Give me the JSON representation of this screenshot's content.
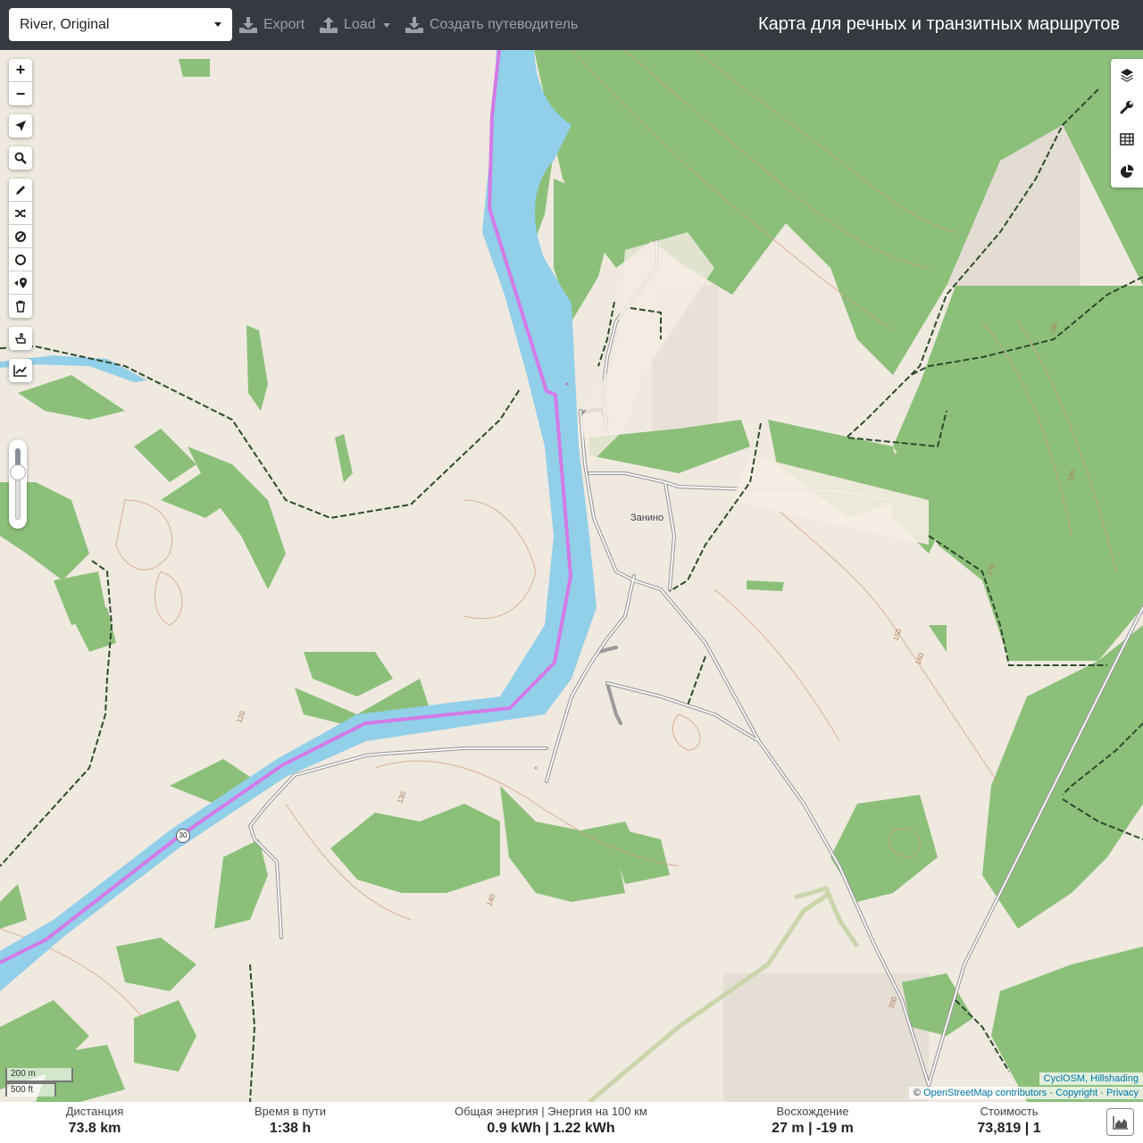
{
  "navbar": {
    "profile": "River, Original",
    "export_label": "Export",
    "load_label": "Load",
    "guide_label": "Создать путеводитель",
    "title": "Карта для речных и транзитных маршрутов"
  },
  "map": {
    "village_label": "Занино",
    "road_shield": "30",
    "contour_labels": [
      "120",
      "130",
      "140",
      "150",
      "160",
      "170",
      "180",
      "190",
      "200"
    ],
    "zoom_level_fraction": 0.3
  },
  "left_tools": {
    "zoom": [
      "zoom-in",
      "zoom-out"
    ],
    "locate": "location-arrow-icon",
    "search": "search-icon",
    "drawing": [
      "pencil-icon",
      "shuffle-icon",
      "ban-icon",
      "circle-icon",
      "poi-icon",
      "trash-icon"
    ],
    "hand": "hand-pointer-icon",
    "elevation": "chart-line-icon"
  },
  "right_tools": [
    "layers-icon",
    "wrench-icon",
    "table-icon",
    "pie-chart-icon"
  ],
  "scale": {
    "metric": "200 m",
    "imperial": "500 ft"
  },
  "attribution": {
    "line1": "CyclOSM, Hillshading",
    "prefix": "©",
    "osm": "OpenStreetMap contributors",
    "sep1": "·",
    "copyright": "Copyright",
    "sep2": "·",
    "privacy": "Privacy"
  },
  "stats": {
    "distance_label": "Дистанция",
    "distance_value": "73.8 km",
    "time_label": "Время в пути",
    "time_value": "1:38 h",
    "energy_label": "Общая энергия | Энергия на 100 км",
    "energy_value": "0.9 kWh | 1.22 kWh",
    "ascent_label": "Восхождение",
    "ascent_value": "27 m | -19 m",
    "cost_label": "Стоимость",
    "cost_value": "73,819 | 1"
  },
  "colors": {
    "navbar": "#343a40",
    "land": "#efe9e0",
    "forest": "#8cc07a",
    "water": "#92cfe9",
    "route": "#d47ae6",
    "boundary": "#2e4a2e",
    "contour": "#d6a283"
  }
}
